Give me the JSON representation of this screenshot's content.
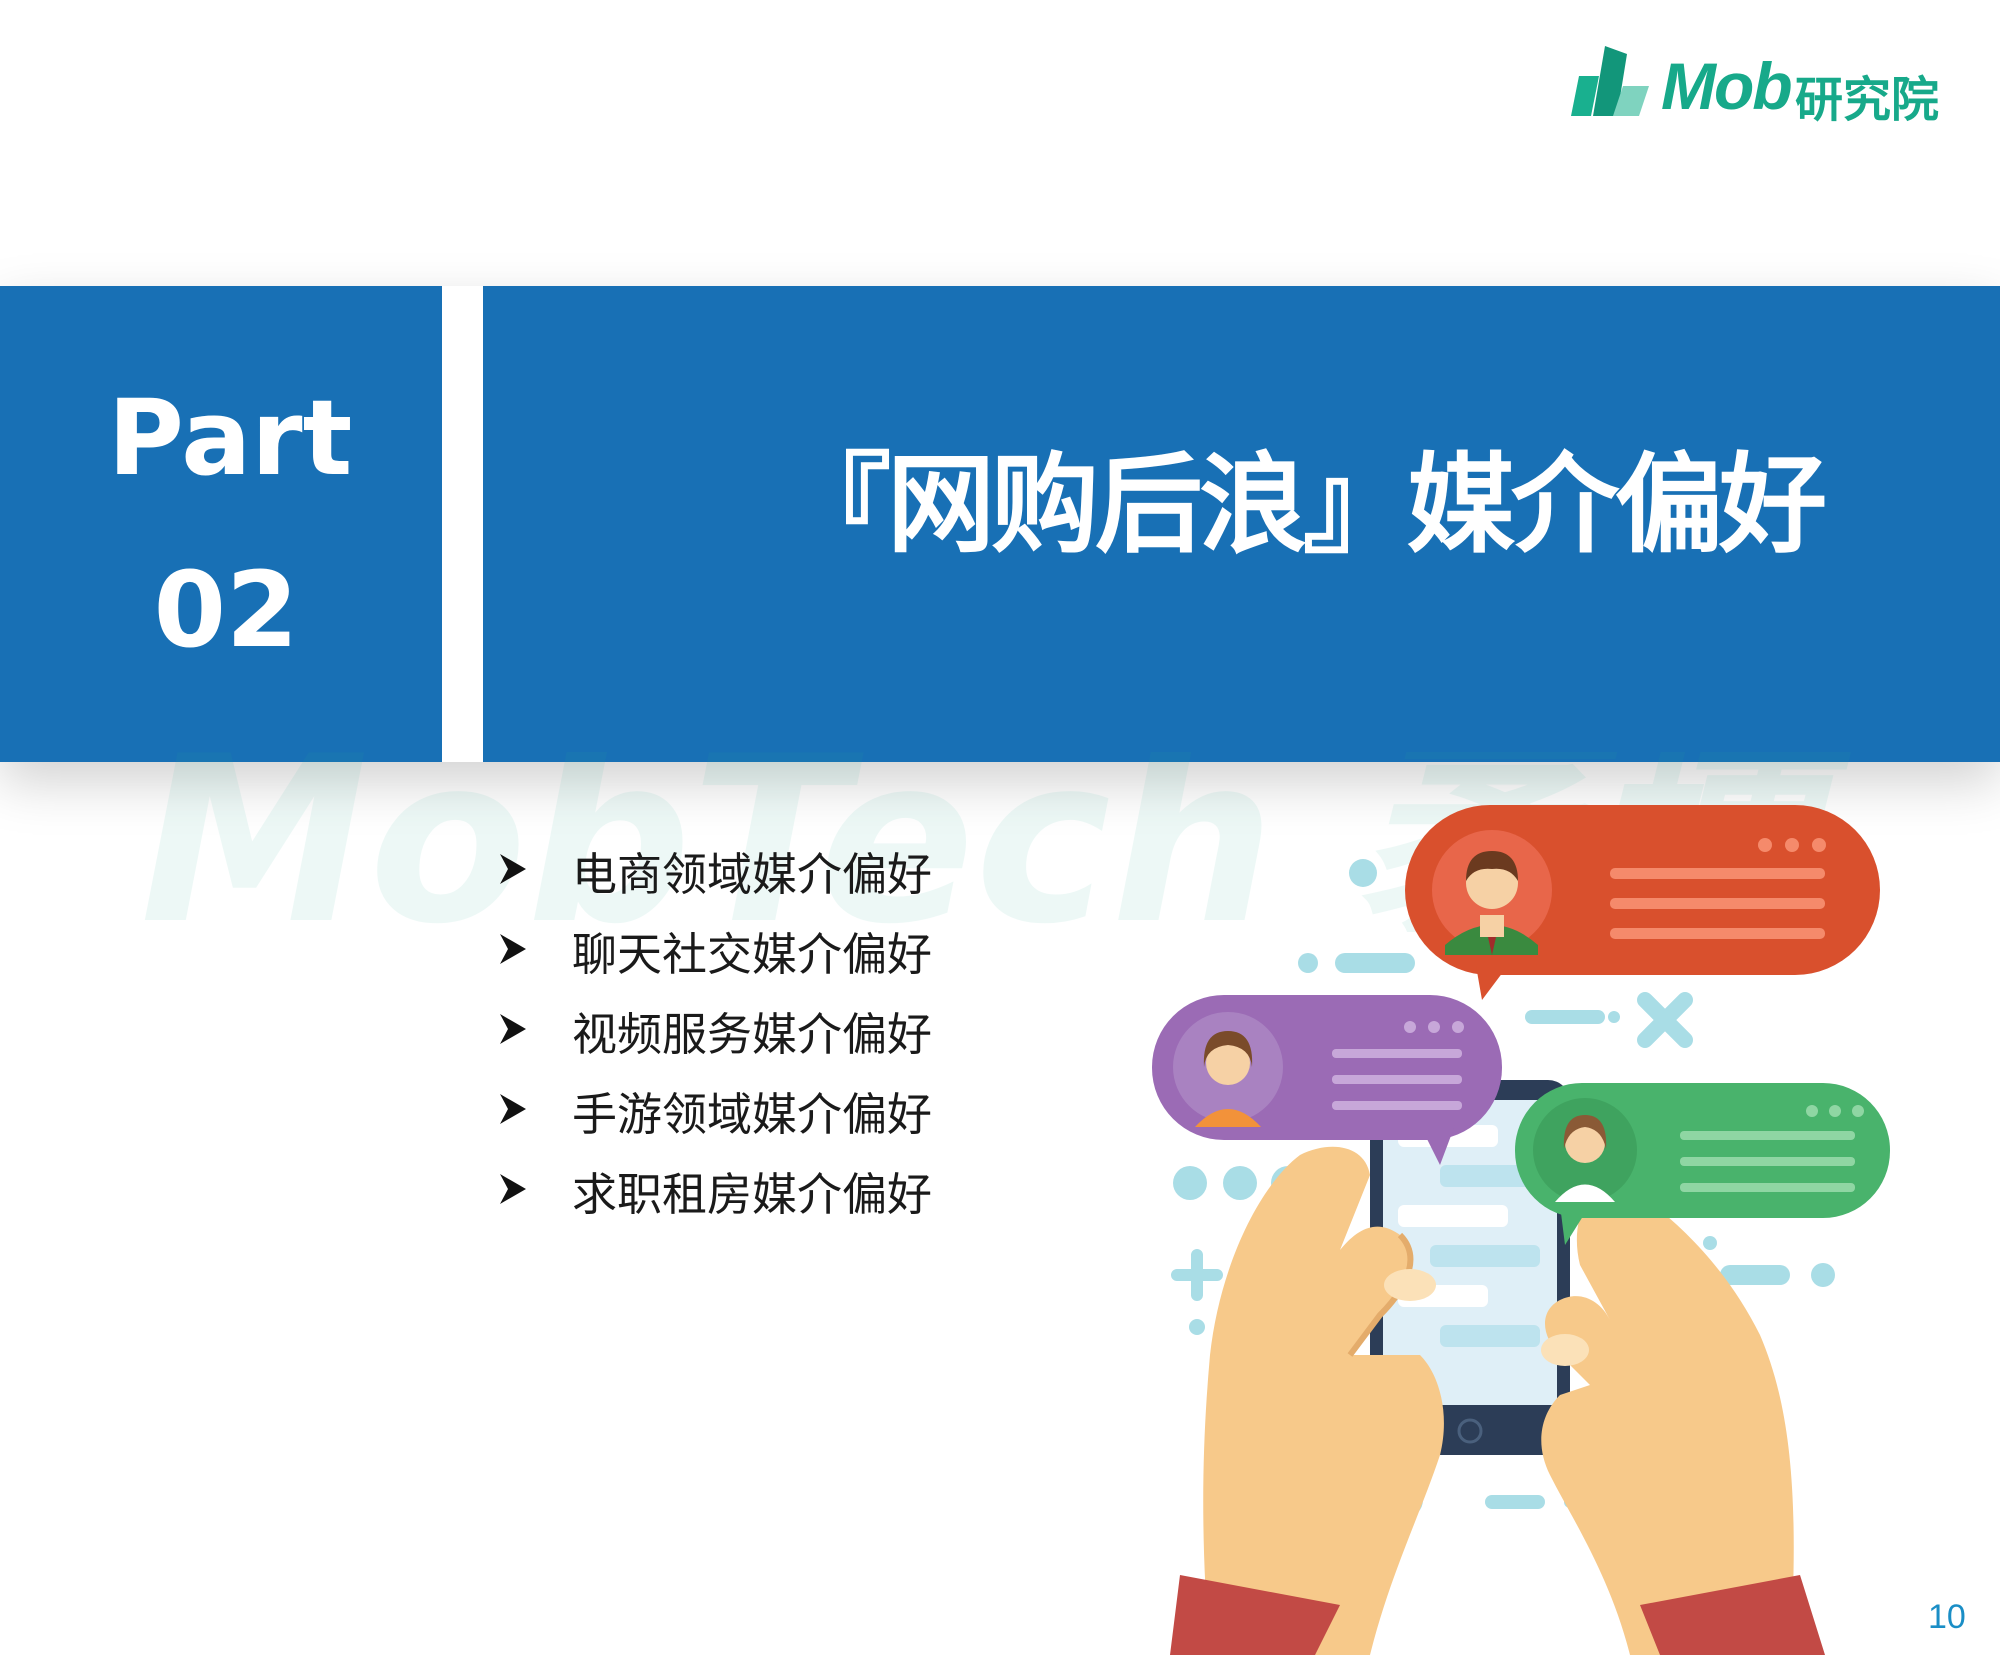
{
  "logo": {
    "latin": "Mob",
    "cjk": "研究院"
  },
  "part": {
    "label": "Part",
    "number": "02"
  },
  "title": "『网购后浪』媒介偏好",
  "watermark": "MobTech 袤博",
  "agenda": [
    "电商领域媒介偏好",
    "聊天社交媒介偏好",
    "视频服务媒介偏好",
    "手游领域媒介偏好",
    "求职租房媒介偏好"
  ],
  "page_number": "10",
  "colors": {
    "primary_blue": "#1870b5",
    "logo_green": "#17a98a",
    "bubble_red": "#d9502d",
    "bubble_purple": "#9b6bb5",
    "bubble_green": "#49b36c"
  }
}
